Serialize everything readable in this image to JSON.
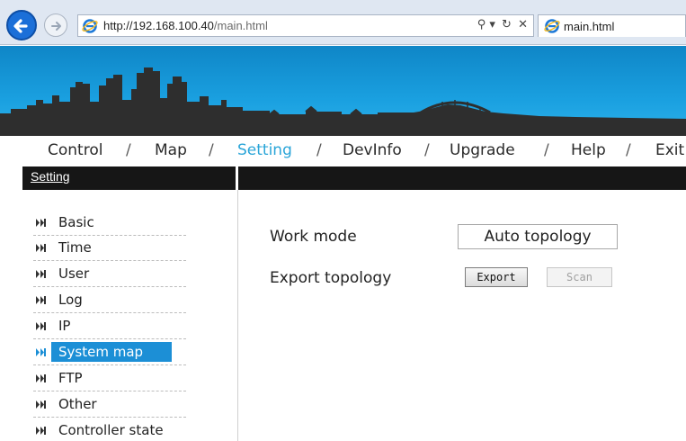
{
  "browser": {
    "url_host": "http://192.168.100.40",
    "url_path": "/main.html",
    "address_controls": [
      "⚲ ▾",
      "↻",
      "✕"
    ],
    "tab_title": "main.html",
    "accent": "#1b6fd8"
  },
  "nav": {
    "items": [
      "Control",
      "Map",
      "Setting",
      "DevInfo",
      "Upgrade",
      "Help",
      "Exit"
    ],
    "separator": "/",
    "active": "Setting",
    "active_color": "#2aa5d8"
  },
  "sidebar": {
    "title": "Setting",
    "items": [
      "Basic",
      "Time",
      "User",
      "Log",
      "IP",
      "System map",
      "FTP",
      "Other",
      "Controller state"
    ],
    "active": "System map",
    "highlight_color": "#1c8fd6"
  },
  "content": {
    "work_mode_label": "Work mode",
    "work_mode_value": "Auto topology",
    "export_label": "Export topology",
    "export_button": "Export",
    "scan_button": "Scan"
  }
}
